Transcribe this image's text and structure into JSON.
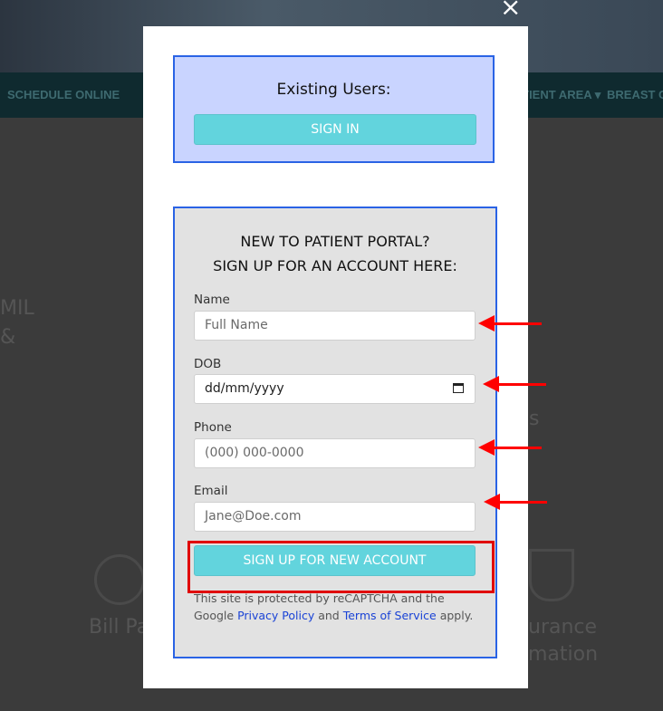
{
  "background": {
    "nav": [
      "SCHEDULE ONLINE",
      "PATIENT AREA ▾",
      "BREAST C"
    ],
    "bits": [
      "MIL",
      "&",
      "Bill Pa",
      "urance",
      "mation",
      "s"
    ]
  },
  "modal": {
    "close": "×",
    "existing": {
      "heading": "Existing Users:",
      "sign_in": "SIGN IN"
    },
    "signup": {
      "heading_line1": "NEW TO PATIENT PORTAL?",
      "heading_line2": "SIGN UP FOR AN ACCOUNT HERE:",
      "fields": [
        {
          "label": "Name",
          "placeholder": "Full Name"
        },
        {
          "label": "DOB",
          "value": "dd/mm/yyyy"
        },
        {
          "label": "Phone",
          "placeholder": "(000) 000-0000"
        },
        {
          "label": "Email",
          "placeholder": "Jane@Doe.com"
        }
      ],
      "submit": "SIGN UP FOR NEW ACCOUNT",
      "fineprint_pre": "This site is protected by reCAPTCHA and the Google ",
      "privacy_link": "Privacy Policy",
      "fineprint_and": " and ",
      "terms_link": "Terms of Service",
      "fineprint_post": " apply."
    }
  },
  "colors": {
    "accent": "#62d4dd",
    "border_blue": "#2a63e5",
    "annotation_red": "#ff0000"
  }
}
